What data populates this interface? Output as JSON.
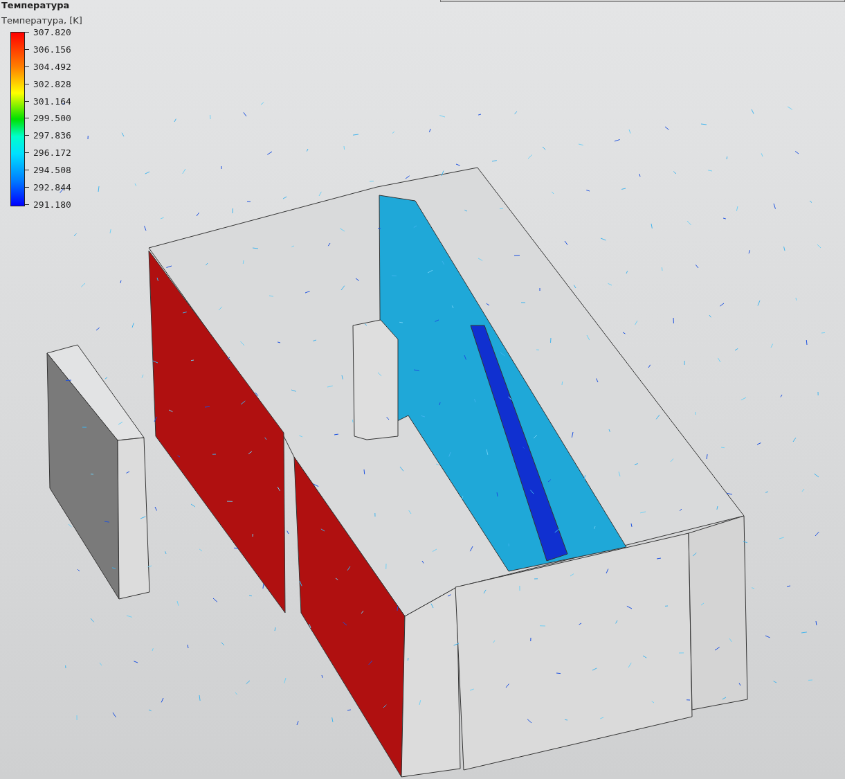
{
  "legend": {
    "title": "Температура",
    "subtitle": "Температура, [K]",
    "ticks": [
      "307.820",
      "306.156",
      "304.492",
      "302.828",
      "301.164",
      "299.500",
      "297.836",
      "296.172",
      "294.508",
      "292.844",
      "291.180"
    ]
  }
}
